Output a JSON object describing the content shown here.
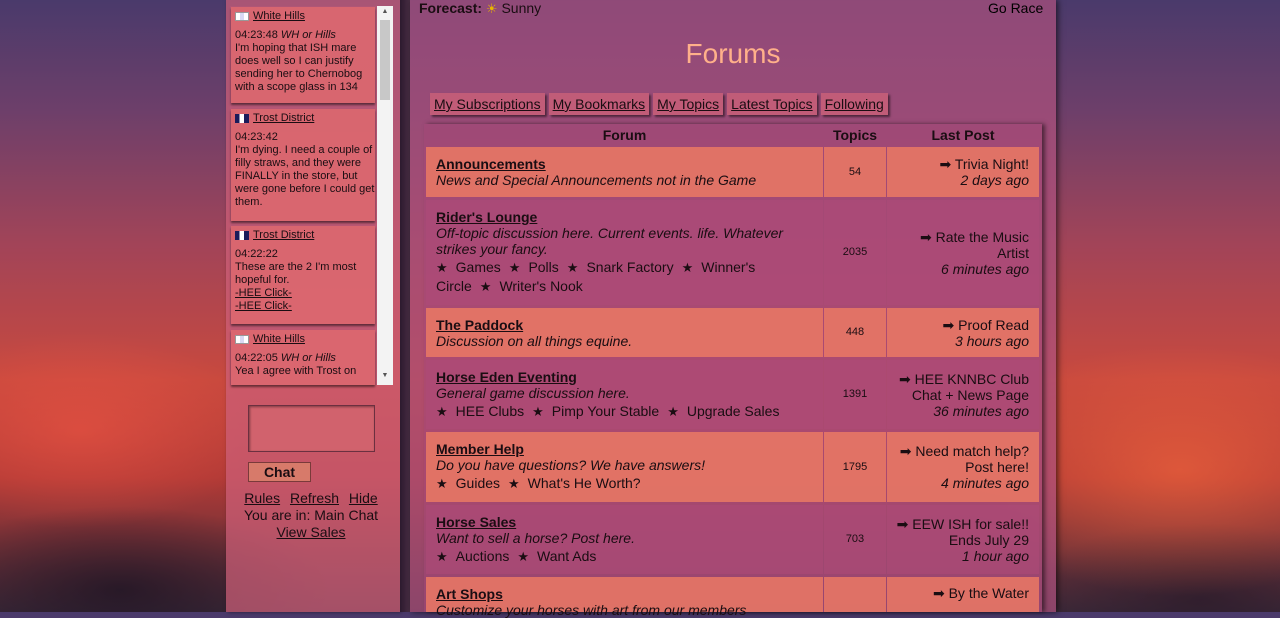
{
  "chat": {
    "messages": [
      {
        "user": "White Hills",
        "flag": "wh",
        "time": "04:23:48",
        "tag": "WH or Hills",
        "text": "I'm hoping that ISH mare does well so I can justify sending her to Chernobog with a scope glass in 134"
      },
      {
        "user": "Trost District",
        "flag": "trost",
        "time": "04:23:42",
        "tag": "",
        "text": "I'm dying. I need a couple of filly straws, and they were FINALLY in the store, but were gone before I could get them."
      },
      {
        "user": "Trost District",
        "flag": "trost",
        "time": "04:22:22",
        "tag": "",
        "text": "These are the 2 I'm most hopeful for.",
        "links": [
          "-HEE Click-",
          "-HEE Click-"
        ]
      },
      {
        "user": "White Hills",
        "flag": "wh",
        "time": "04:22:05",
        "tag": "WH or Hills",
        "text": "Yea I agree with Trost on"
      }
    ],
    "chat_button": "Chat",
    "links": {
      "rules": "Rules",
      "refresh": "Refresh",
      "hide": "Hide",
      "location": "You are in: Main Chat",
      "view_sales": "View Sales"
    }
  },
  "header": {
    "forecast_label": "Forecast:",
    "forecast_value": "Sunny",
    "go_race": "Go Race",
    "title": "Forums"
  },
  "tabs": [
    "My Subscriptions",
    "My Bookmarks",
    "My Topics",
    "Latest Topics",
    "Following"
  ],
  "table": {
    "headers": {
      "forum": "Forum",
      "topics": "Topics",
      "last_post": "Last Post"
    },
    "rows": [
      {
        "name": "Announcements",
        "desc": "News and Special Announcements not in the Game",
        "subs": [],
        "topics": "54",
        "last_title": "Trivia Night!",
        "last_ago": "2 days ago"
      },
      {
        "name": "Rider's Lounge",
        "desc": "Off-topic discussion here. Current events. life. Whatever strikes your fancy.",
        "subs": [
          "Games",
          "Polls",
          "Snark Factory",
          "Winner's Circle",
          "Writer's Nook"
        ],
        "topics": "2035",
        "last_title": "Rate the Music Artist",
        "last_ago": "6 minutes ago"
      },
      {
        "name": "The Paddock",
        "desc": "Discussion on all things equine.",
        "subs": [],
        "topics": "448",
        "last_title": "Proof Read",
        "last_ago": "3 hours ago"
      },
      {
        "name": "Horse Eden Eventing",
        "desc": "General game discussion here.",
        "subs": [
          "HEE Clubs",
          "Pimp Your Stable",
          "Upgrade Sales"
        ],
        "topics": "1391",
        "last_title": "HEE KNNBC Club Chat + News Page",
        "last_ago": "36 minutes ago"
      },
      {
        "name": "Member Help",
        "desc": "Do you have questions? We have answers!",
        "subs": [
          "Guides",
          "What's He Worth?"
        ],
        "topics": "1795",
        "last_title": "Need match help? Post here!",
        "last_ago": "4 minutes ago"
      },
      {
        "name": "Horse Sales",
        "desc": "Want to sell a horse? Post here.",
        "subs": [
          "Auctions",
          "Want Ads"
        ],
        "topics": "703",
        "last_title": "EEW ISH for sale!! Ends July 29",
        "last_ago": "1 hour ago"
      },
      {
        "name": "Art Shops",
        "desc": "Customize your horses with art from our members",
        "subs": [],
        "topics": "",
        "last_title": "By the Water",
        "last_ago": ""
      }
    ]
  }
}
